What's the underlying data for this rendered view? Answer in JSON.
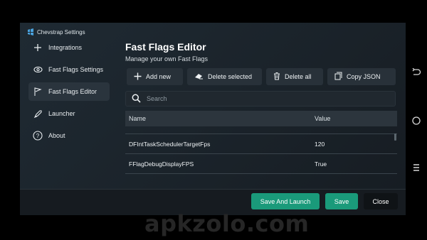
{
  "app": {
    "title": "Chevstrap Settings"
  },
  "sidebar": {
    "items": [
      {
        "label": "Integrations",
        "icon": "plus-icon"
      },
      {
        "label": "Fast Flags Settings",
        "icon": "eye-icon"
      },
      {
        "label": "Fast Flags Editor",
        "icon": "flag-icon",
        "active": true
      },
      {
        "label": "Launcher",
        "icon": "rocket-icon"
      },
      {
        "label": "About",
        "icon": "help-icon"
      }
    ]
  },
  "main": {
    "title": "Fast Flags Editor",
    "subtitle": "Manage your own Fast Flags",
    "toolbar": {
      "add": "Add new",
      "delete_selected": "Delete selected",
      "delete_all": "Delete all",
      "copy_json": "Copy JSON"
    },
    "search": {
      "placeholder": "Search"
    },
    "table": {
      "headers": [
        "Name",
        "Value"
      ],
      "rows": [
        {
          "name": "DFIntTaskSchedulerTargetFps",
          "value": "120"
        },
        {
          "name": "FFlagDebugDisplayFPS",
          "value": "True"
        }
      ]
    }
  },
  "footer": {
    "save_launch": "Save And Launch",
    "save": "Save",
    "close": "Close"
  },
  "colors": {
    "accent": "#1a9a7a",
    "background": "#1f2a33"
  },
  "watermark": "apkzolo.com"
}
